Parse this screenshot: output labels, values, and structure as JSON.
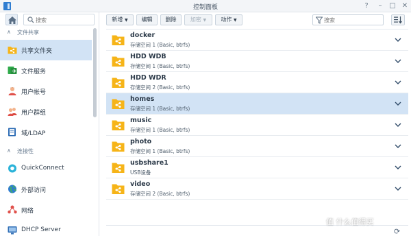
{
  "window": {
    "title": "控制面板",
    "help_label": "?",
    "minimize_label": "–",
    "maximize_label": "□",
    "close_label": "✕"
  },
  "sidebar": {
    "search_placeholder": "搜索",
    "sections": [
      {
        "label": "文件共享"
      },
      {
        "label": "连接性"
      }
    ],
    "items": [
      {
        "label": "共享文件夹",
        "icon": "share-folder-icon",
        "active": true
      },
      {
        "label": "文件服务",
        "icon": "file-services-icon"
      },
      {
        "label": "用户帐号",
        "icon": "user-icon"
      },
      {
        "label": "用户群组",
        "icon": "group-icon"
      },
      {
        "label": "域/LDAP",
        "icon": "domain-ldap-icon"
      },
      {
        "label": "QuickConnect",
        "icon": "quickconnect-icon"
      },
      {
        "label": "外部访问",
        "icon": "globe-icon"
      },
      {
        "label": "网络",
        "icon": "network-icon"
      },
      {
        "label": "DHCP Server",
        "icon": "dhcp-icon"
      }
    ]
  },
  "toolbar": {
    "create_label": "新增",
    "edit_label": "编辑",
    "delete_label": "删除",
    "encrypt_label": "加密",
    "action_label": "动作",
    "filter_placeholder": "搜索"
  },
  "folders": [
    {
      "name": "docker",
      "desc": "存储空间 1 (Basic, btrfs)"
    },
    {
      "name": "HDD WDB",
      "desc": "存储空间 1 (Basic, btrfs)"
    },
    {
      "name": "HDD WDR",
      "desc": "存储空间 2 (Basic, btrfs)"
    },
    {
      "name": "homes",
      "desc": "存储空间 1 (Basic, btrfs)",
      "selected": true
    },
    {
      "name": "music",
      "desc": "存储空间 1 (Basic, btrfs)"
    },
    {
      "name": "photo",
      "desc": "存储空间 1 (Basic, btrfs)"
    },
    {
      "name": "usbshare1",
      "desc": "USB设备"
    },
    {
      "name": "video",
      "desc": "存储空间 2 (Basic, btrfs)"
    }
  ],
  "watermark": "值 什么值得买",
  "colors": {
    "accent": "#2f7dd1",
    "selection": "#d2e3f5",
    "folder": "#f6b418"
  }
}
